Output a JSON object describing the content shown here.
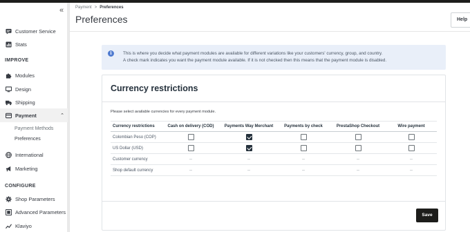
{
  "sidebar": {
    "collapse_icon": "«",
    "items_top": [
      {
        "label": "Customer Service",
        "icon": "chat-icon"
      },
      {
        "label": "Stats",
        "icon": "stats-icon"
      }
    ],
    "section_improve": "IMPROVE",
    "items_improve": [
      {
        "label": "Modules",
        "icon": "puzzle-icon"
      },
      {
        "label": "Design",
        "icon": "monitor-icon"
      },
      {
        "label": "Shipping",
        "icon": "truck-icon"
      },
      {
        "label": "Payment",
        "icon": "card-icon",
        "active": true
      }
    ],
    "payment_caret": "⌃",
    "payment_subitems": [
      "Payment Methods",
      "Preferences"
    ],
    "items_improve_2": [
      {
        "label": "International",
        "icon": "globe-icon"
      },
      {
        "label": "Marketing",
        "icon": "megaphone-icon"
      }
    ],
    "section_configure": "CONFIGURE",
    "items_configure": [
      {
        "label": "Shop Parameters",
        "icon": "gear-icon"
      },
      {
        "label": "Advanced Parameters",
        "icon": "settings-icon"
      },
      {
        "label": "Klaviyo",
        "icon": "chart-line-icon"
      }
    ]
  },
  "header": {
    "breadcrumb": [
      "Payment",
      "Preferences"
    ],
    "breadcrumb_sep": ">",
    "title": "Preferences",
    "help_label": "Help"
  },
  "alert": {
    "icon": "i",
    "line1": "This is where you decide what payment modules are available for different variations like your customers' currency, group, and country.",
    "line2": "A check mark indicates you want the payment module available. If it is not checked then this means that the payment module is disabled."
  },
  "card": {
    "title": "Currency restrictions",
    "description": "Please select available currencies for every payment module.",
    "table": {
      "columns": [
        "Currency restrictions",
        "Cash on delivery (COD)",
        "Payments Way Merchant",
        "Payments by check",
        "PrestaShop Checkout",
        "Wire payment"
      ],
      "rows": [
        {
          "label": "Colombian Peso (COP)",
          "cells": [
            "box",
            "checked",
            "box",
            "box",
            "box"
          ]
        },
        {
          "label": "US Dollar (USD)",
          "cells": [
            "box",
            "checked",
            "box",
            "box",
            "box"
          ]
        },
        {
          "label": "Customer currency",
          "cells": [
            "--",
            "--",
            "--",
            "--",
            "--"
          ]
        },
        {
          "label": "Shop default currency",
          "cells": [
            "--",
            "--",
            "--",
            "--",
            "--"
          ]
        }
      ]
    },
    "save_label": "Save"
  },
  "colors": {
    "accent_dark": "#1d1d1b",
    "alert_bg": "#e9eff9",
    "info_blue": "#4f7bd0"
  }
}
